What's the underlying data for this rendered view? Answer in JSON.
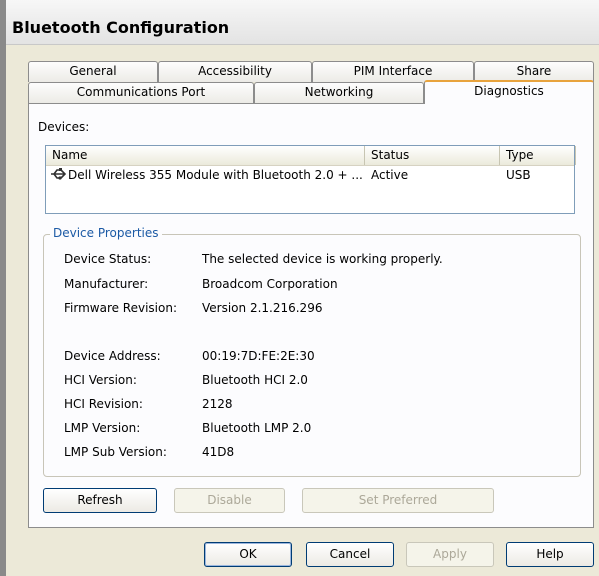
{
  "window": {
    "title": "Bluetooth Configuration"
  },
  "tabs": {
    "row1": [
      "General",
      "Accessibility",
      "PIM Interface",
      "Share"
    ],
    "row2": [
      "Communications Port",
      "Networking",
      "Diagnostics"
    ],
    "active": "Diagnostics"
  },
  "devices": {
    "label": "Devices:",
    "columns": [
      "Name",
      "Status",
      "Type"
    ],
    "rows": [
      {
        "icon": "bluetooth-device-icon",
        "name": "Dell Wireless 355 Module with Bluetooth 2.0 + ...",
        "status": "Active",
        "type": "USB"
      }
    ]
  },
  "properties": {
    "group_title": "Device Properties",
    "items": [
      {
        "label": "Device Status:",
        "value": "The selected device is working properly."
      },
      {
        "label": "Manufacturer:",
        "value": "Broadcom Corporation"
      },
      {
        "label": "Firmware Revision:",
        "value": "Version 2.1.216.296"
      },
      {
        "label": "Device Address:",
        "value": "00:19:7D:FE:2E:30"
      },
      {
        "label": "HCI Version:",
        "value": "Bluetooth HCI 2.0"
      },
      {
        "label": "HCI Revision:",
        "value": "2128"
      },
      {
        "label": "LMP Version:",
        "value": "Bluetooth LMP 2.0"
      },
      {
        "label": "LMP Sub Version:",
        "value": "41D8"
      }
    ]
  },
  "panel_buttons": {
    "refresh": "Refresh",
    "disable": "Disable",
    "set_preferred": "Set Preferred"
  },
  "dialog_buttons": {
    "ok": "OK",
    "cancel": "Cancel",
    "apply": "Apply",
    "help": "Help"
  }
}
